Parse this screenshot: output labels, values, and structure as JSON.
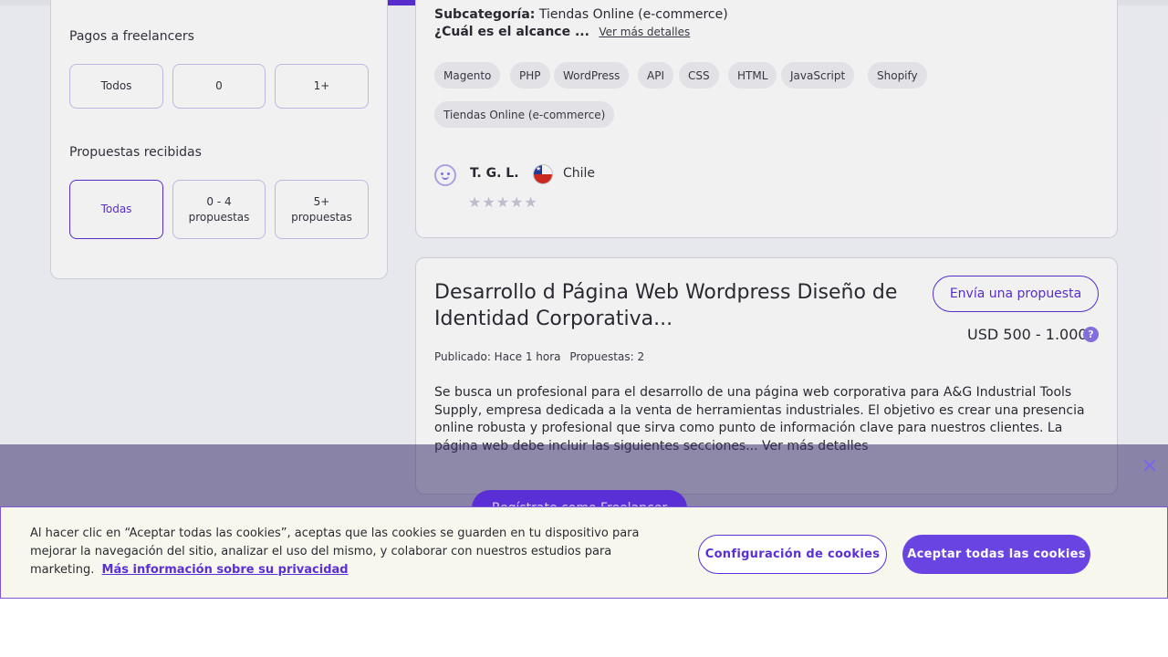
{
  "filters": {
    "payments": {
      "title": "Pagos a freelancers",
      "options": [
        "Todos",
        "0",
        "1+"
      ]
    },
    "proposals": {
      "title": "Propuestas recibidas",
      "options": [
        "Todas",
        "0 - 4 propuestas",
        "5+ propuestas"
      ]
    }
  },
  "project1": {
    "subcategory_label": "Subcategoría:",
    "subcategory_value": "Tiendas Online (e-commerce)",
    "scope_label": "¿Cuál es el alcance ...",
    "more_details": "Ver más detalles",
    "tags": [
      "Magento",
      "PHP",
      "WordPress",
      "API",
      "CSS",
      "HTML",
      "JavaScript",
      "Shopify",
      "Tiendas Online (e-commerce)"
    ],
    "client_name": "T. G. L.",
    "country": "Chile",
    "rating": 0
  },
  "project2": {
    "title": "Desarrollo d Página Web Wordpress Diseño de Identidad Corporativa...",
    "propose_label": "Envía una propuesta",
    "budget": "USD 500 - 1.000",
    "published": "Publicado: Hace 1 hora",
    "proposals": "Propuestas: 2",
    "description": "Se busca un profesional para el desarrollo de una página web corporativa para A&G Industrial Tools Supply, empresa dedicada a la venta de herramientas industriales. El objetivo es crear una presencia online robusta y profesional que sirva como punto de información clave para nuestros clientes. La página web debe incluir las siguientes secciones... Ver más detalles"
  },
  "overlay": {
    "register_label": "Regístrate como Freelancer"
  },
  "cookies": {
    "text": "Al hacer clic en “Aceptar todas las cookies”, aceptas que las cookies se guarden en tu dispositivo para mejorar la navegación del sitio, analizar el uso del mismo, y colaborar con nuestros estudios para marketing.",
    "privacy_link": "Más información sobre su privacidad",
    "settings_label": "Configuración de cookies",
    "accept_label": "Aceptar todas las cookies"
  },
  "colors": {
    "accent": "#5b2fd6",
    "accept_button": "#6a44e3"
  }
}
